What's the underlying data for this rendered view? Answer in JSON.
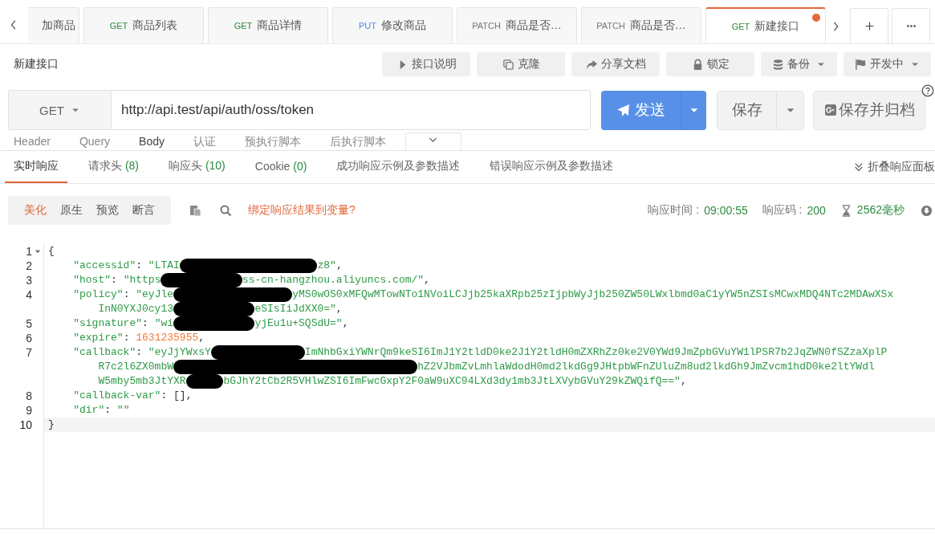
{
  "tabs": [
    {
      "name": "加商品",
      "selected": false,
      "modified": false
    },
    {
      "method": "GET",
      "name": "商品列表",
      "selected": false,
      "modified": false
    },
    {
      "method": "GET",
      "name": "商品详情",
      "selected": false,
      "modified": false
    },
    {
      "method": "PUT",
      "name": "修改商品",
      "selected": false,
      "modified": false
    },
    {
      "method": "PATCH",
      "name": "商品是否…",
      "selected": false,
      "modified": false
    },
    {
      "method": "PATCH",
      "name": "商品是否…",
      "selected": false,
      "modified": false
    },
    {
      "method": "GET",
      "name": "新建接口",
      "selected": true,
      "modified": true
    }
  ],
  "title": "新建接口",
  "actions": [
    {
      "label": "接口说明",
      "dropdown": false
    },
    {
      "label": "克隆",
      "dropdown": false
    },
    {
      "label": "分享文档",
      "dropdown": false
    },
    {
      "label": "锁定",
      "dropdown": false
    },
    {
      "label": "备份",
      "dropdown": true
    },
    {
      "label": "开发中",
      "dropdown": true
    }
  ],
  "request": {
    "method": "GET",
    "url": "http://api.test/api/auth/oss/token",
    "send": "发送",
    "save": "保存",
    "save_archive": "保存并归档"
  },
  "request_tabs": [
    {
      "label": "Header",
      "selected": false
    },
    {
      "label": "Query",
      "selected": false
    },
    {
      "label": "Body",
      "selected": true
    },
    {
      "label": "认证",
      "selected": false
    },
    {
      "label": "预执行脚本",
      "selected": false
    },
    {
      "label": "后执行脚本",
      "selected": false
    }
  ],
  "response_tabs": [
    {
      "label": "实时响应",
      "selected": true
    },
    {
      "label": "请求头",
      "count": "(8)",
      "selected": false
    },
    {
      "label": "响应头",
      "count": "(10)",
      "selected": false
    },
    {
      "label": "Cookie",
      "count": "(0)",
      "selected": false
    },
    {
      "label": "成功响应示例及参数描述",
      "selected": false
    },
    {
      "label": "错误响应示例及参数描述",
      "selected": false
    }
  ],
  "collapse_panel": "折叠响应面板",
  "view_modes": [
    {
      "label": "美化",
      "selected": true
    },
    {
      "label": "原生",
      "selected": false
    },
    {
      "label": "预览",
      "selected": false
    },
    {
      "label": "断言",
      "selected": false
    }
  ],
  "bind_link": "绑定响应结果到变量?",
  "stats": {
    "time_label": "响应时间 :",
    "time": "09:00:55",
    "code_label": "响应码 :",
    "code": "200",
    "duration": "2562毫秒"
  },
  "code_lines": [
    {
      "number": "1",
      "foldable": true,
      "active": false,
      "rows": [
        {
          "parts": [
            {
              "kind": "punct",
              "text": "{"
            }
          ]
        }
      ]
    },
    {
      "number": "2",
      "foldable": false,
      "active": false,
      "rows": [
        {
          "parts": [
            {
              "kind": "key",
              "text": "\"accessid\""
            },
            {
              "kind": "punct",
              "text": ": "
            },
            {
              "kind": "str",
              "text": "\"LTAI"
            },
            {
              "kind": "redacted"
            },
            {
              "kind": "str",
              "text": "z8\""
            },
            {
              "kind": "punct",
              "text": ","
            }
          ]
        }
      ]
    },
    {
      "number": "3",
      "foldable": false,
      "active": false,
      "rows": [
        {
          "parts": [
            {
              "kind": "key",
              "text": "\"host\""
            },
            {
              "kind": "punct",
              "text": ": "
            },
            {
              "kind": "str",
              "text": "\"https"
            },
            {
              "kind": "redacted"
            },
            {
              "kind": "str",
              "text": "ss-cn-hangzhou.aliyuncs.com/\""
            },
            {
              "kind": "punct",
              "text": ","
            }
          ]
        }
      ]
    },
    {
      "number": "4",
      "foldable": false,
      "active": false,
      "rows": [
        {
          "parts": [
            {
              "kind": "key",
              "text": "\"policy\""
            },
            {
              "kind": "punct",
              "text": ": "
            },
            {
              "kind": "str",
              "text": "\"eyJle"
            },
            {
              "kind": "redacted"
            },
            {
              "kind": "str",
              "text": "yMS0wOS0xMFQwMTowNTo1NVoiLCJjb25kaXRpb25zIjpbWyJjb250ZW50LWxlbmd0aC1yYW5nZSIsMCwxMDQ4NTc2MDAwXSx"
            }
          ]
        },
        {
          "parts": [
            {
              "kind": "str",
              "text": "InN0YXJ0cy13"
            },
            {
              "kind": "redacted"
            },
            {
              "kind": "str",
              "text": "eSIsIiJdXX0=\""
            },
            {
              "kind": "punct",
              "text": ","
            }
          ]
        }
      ]
    },
    {
      "number": "5",
      "foldable": false,
      "active": false,
      "rows": [
        {
          "parts": [
            {
              "kind": "key",
              "text": "\"signature\""
            },
            {
              "kind": "punct",
              "text": ": "
            },
            {
              "kind": "str",
              "text": "\"wi"
            },
            {
              "kind": "redacted"
            },
            {
              "kind": "str",
              "text": "yjEu1u+SQSdU=\""
            },
            {
              "kind": "punct",
              "text": ","
            }
          ]
        }
      ]
    },
    {
      "number": "6",
      "foldable": false,
      "active": false,
      "rows": [
        {
          "parts": [
            {
              "kind": "key",
              "text": "\"expire\""
            },
            {
              "kind": "punct",
              "text": ": "
            },
            {
              "kind": "num",
              "text": "1631235955"
            },
            {
              "kind": "punct",
              "text": ","
            }
          ]
        }
      ]
    },
    {
      "number": "7",
      "foldable": false,
      "active": false,
      "rows": [
        {
          "parts": [
            {
              "kind": "key",
              "text": "\"callback\""
            },
            {
              "kind": "punct",
              "text": ": "
            },
            {
              "kind": "str",
              "text": "\"eyJjYWxsY"
            },
            {
              "kind": "redacted"
            },
            {
              "kind": "str",
              "text": "ImNhbGxiYWNrQm9keSI6ImJ1Y2tldD0ke2J1Y2tldH0mZXRhZz0ke2V0YWd9JmZpbGVuYW1lPSR7b2JqZWN0fSZzaXplP"
            }
          ]
        },
        {
          "parts": [
            {
              "kind": "str",
              "text": "R7c2l6ZX0mbW"
            },
            {
              "kind": "redacted"
            },
            {
              "kind": "str",
              "text": "hZ2VJbmZvLmhlaWdodH0md2lkdGg9JHtpbWFnZUluZm8ud2lkdGh9JmZvcm1hdD0ke2ltYWdl"
            }
          ]
        },
        {
          "parts": [
            {
              "kind": "str",
              "text": "W5mby5mb3JtYXR"
            },
            {
              "kind": "redacted"
            },
            {
              "kind": "str",
              "text": "bGJhY2tCb2R5VHlwZSI6ImFwcGxpY2F0aW9uXC94LXd3dy1mb3JtLXVybGVuY29kZWQifQ==\""
            },
            {
              "kind": "punct",
              "text": ","
            }
          ]
        }
      ]
    },
    {
      "number": "8",
      "foldable": false,
      "active": false,
      "rows": [
        {
          "parts": [
            {
              "kind": "key",
              "text": "\"callback-var\""
            },
            {
              "kind": "punct",
              "text": ": [],"
            }
          ]
        }
      ]
    },
    {
      "number": "9",
      "foldable": false,
      "active": false,
      "rows": [
        {
          "parts": [
            {
              "kind": "key",
              "text": "\"dir\""
            },
            {
              "kind": "punct",
              "text": ": "
            },
            {
              "kind": "str",
              "text": "\"\""
            }
          ]
        }
      ]
    },
    {
      "number": "10",
      "foldable": false,
      "active": true,
      "rows": [
        {
          "parts": [
            {
              "kind": "punct",
              "text": "}"
            }
          ]
        }
      ]
    }
  ]
}
